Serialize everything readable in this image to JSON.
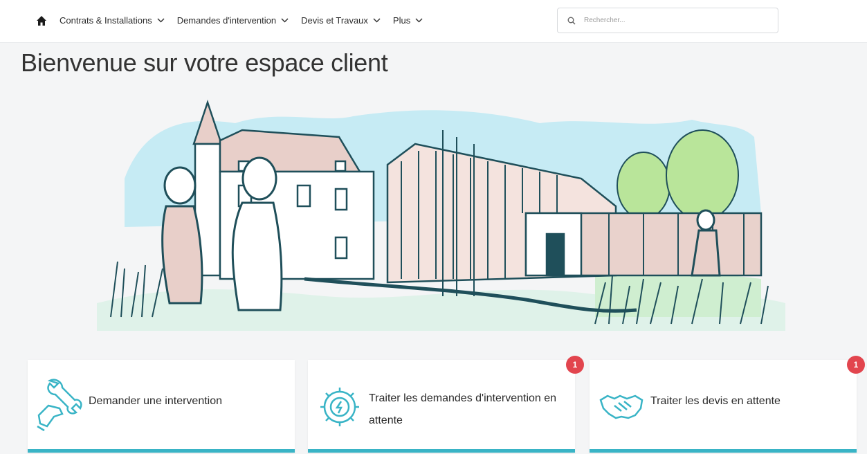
{
  "nav": {
    "home_icon": "home-icon",
    "items": [
      {
        "label": "Contrats & Installations"
      },
      {
        "label": "Demandes d'intervention"
      },
      {
        "label": "Devis et Travaux"
      },
      {
        "label": "Plus"
      }
    ]
  },
  "search": {
    "placeholder": "Rechercher...",
    "value": ""
  },
  "page": {
    "title": "Bienvenue sur votre espace client"
  },
  "cards": [
    {
      "label": "Demander une intervention",
      "icon": "wrench-hand-icon",
      "badge": ""
    },
    {
      "label": "Traiter les demandes d'intervention en attente",
      "icon": "gear-bolt-icon",
      "badge": "1"
    },
    {
      "label": "Traiter les devis en attente",
      "icon": "handshake-icon",
      "badge": "1"
    }
  ],
  "colors": {
    "accent": "#39b4c6",
    "badge": "#e2454e"
  }
}
